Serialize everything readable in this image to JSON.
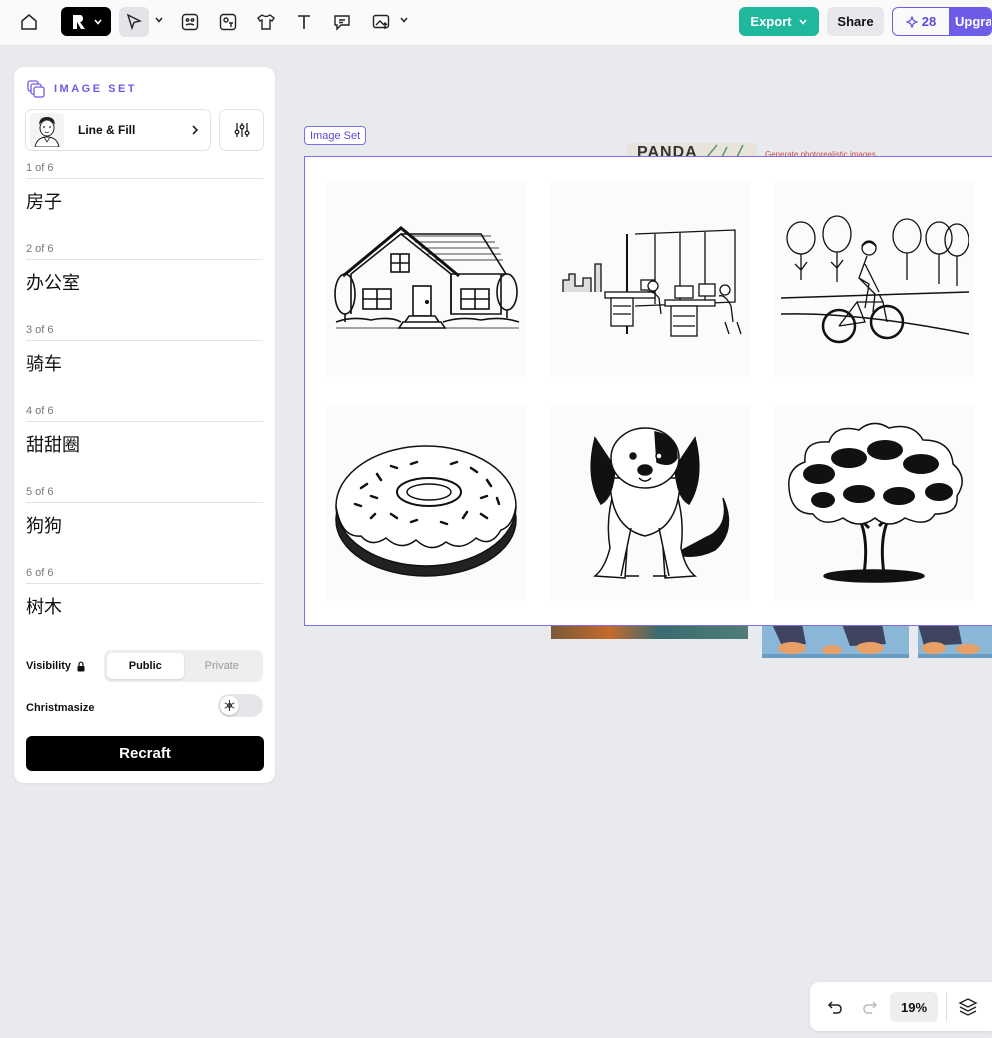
{
  "toolbar": {
    "export_label": "Export",
    "share_label": "Share",
    "credits": "28",
    "upgrade_label": "Upgrade"
  },
  "panel": {
    "title": "IMAGE SET",
    "style_name": "Line & Fill",
    "prompts": [
      {
        "count": "1 of 6",
        "text": "房子"
      },
      {
        "count": "2 of 6",
        "text": "办公室"
      },
      {
        "count": "3 of 6",
        "text": "骑车"
      },
      {
        "count": "4 of 6",
        "text": "甜甜圈"
      },
      {
        "count": "5 of 6",
        "text": "狗狗"
      },
      {
        "count": "6 of 6",
        "text": "树木"
      }
    ],
    "visibility_label": "Visibility",
    "visibility_options": [
      "Public",
      "Private"
    ],
    "visibility_selected": "Public",
    "christmasize_label": "Christmasize",
    "christmasize_on": false,
    "recraft_label": "Recraft"
  },
  "canvas": {
    "set_tag": "Image Set",
    "background_caption": "Generate photorealistic images",
    "background_logo_text": "PANDA",
    "images": [
      "house",
      "office",
      "cyclist",
      "donut",
      "dog",
      "tree"
    ]
  },
  "bottom": {
    "zoom": "19%"
  },
  "colors": {
    "accent": "#6c5ce7",
    "export": "#1fb89c",
    "canvas_bg": "#e9eaee"
  }
}
